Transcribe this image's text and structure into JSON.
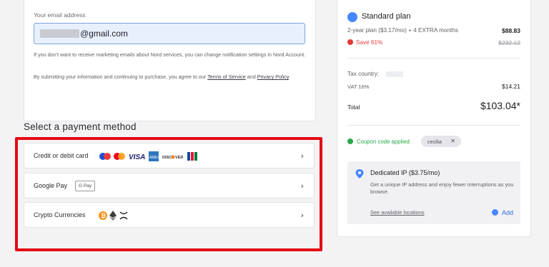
{
  "email": {
    "label": "Your email address",
    "value": "@gmail.com",
    "note1": "If you don't want to receive marketing emails about Nord services, you can change notification settings in Nord Account.",
    "note2_prefix": "By submitting your information and continuing to purchase, you agree to our ",
    "terms": "Terms of Service",
    "and": " and ",
    "privacy": "Privacy Policy",
    "period": "."
  },
  "payment": {
    "title": "Select a payment method",
    "methods": [
      {
        "label": "Credit or debit card",
        "icons": [
          "mastercard-icon",
          "maestro-icon",
          "visa-icon",
          "amex-icon",
          "discover-icon",
          "jcb-icon"
        ]
      },
      {
        "label": "Google Pay",
        "badge": "G Pay"
      },
      {
        "label": "Crypto Currencies",
        "icons": [
          "bitcoin-icon",
          "ethereum-icon",
          "ripple-icon"
        ]
      }
    ],
    "chevron": "›"
  },
  "plan": {
    "name": "Standard plan",
    "description": "2-year plan ($3.17/mo) + 4 EXTRA months",
    "price": "$88.83",
    "save": "Save 61%",
    "old_price": "$232.12",
    "tax_country_label": "Tax country:",
    "vat_label": "VAT 16%",
    "vat_value": "$14.21",
    "total_label": "Total",
    "total_value": "$103.04*",
    "coupon_label": "Coupon code applied:",
    "coupon_code": "cecilia",
    "coupon_remove": "✕",
    "dedicated_ip_title": "Dedicated IP ($3.75/mo)",
    "dedicated_ip_desc": "Get a unique IP address and enjoy fewer interruptions as you browse.",
    "locations_link": "See available locations",
    "add_label": "Add"
  },
  "colors": {
    "accent": "#4687ff",
    "highlight": "#e50914",
    "save": "#e53939",
    "coupon": "#27a94b"
  }
}
